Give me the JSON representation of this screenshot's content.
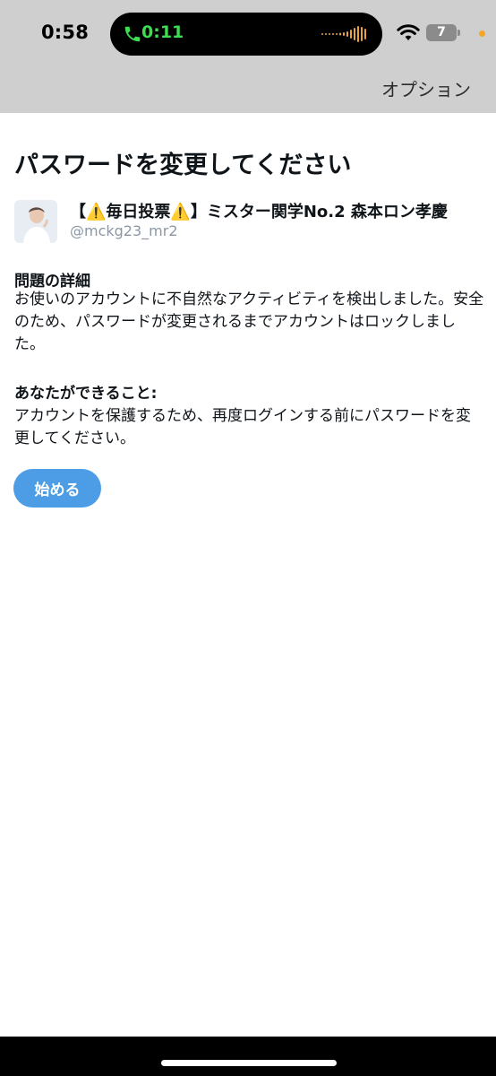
{
  "status_bar": {
    "time": "0:58",
    "call_time": "0:11",
    "battery_level": "7",
    "colors": {
      "call_green": "#3ddc52",
      "privacy_dot": "#f5a623"
    },
    "icons": [
      "phone-icon",
      "audio-wave-icon",
      "wifi-icon",
      "battery-icon"
    ]
  },
  "nav": {
    "options_label": "オプション"
  },
  "main": {
    "title": "パスワードを変更してください",
    "account": {
      "name": "【⚠️毎日投票⚠️】ミスター関学No.2 森本ロン孝慶",
      "handle": "@mckg23_mr2"
    },
    "problem": {
      "heading": "問題の詳細",
      "body": "お使いのアカウントに不自然なアクティビティを検出しました。安全のため、パスワードが変更されるまでアカウントはロックしました。"
    },
    "actions": {
      "heading": "あなたができること:",
      "body": "アカウントを保護するため、再度ログインする前にパスワードを変更してください。"
    },
    "start_button_label": "始める"
  },
  "colors": {
    "accent": "#4c9de6",
    "top_background": "#cfcfcf",
    "handle_gray": "#8a98a5"
  }
}
